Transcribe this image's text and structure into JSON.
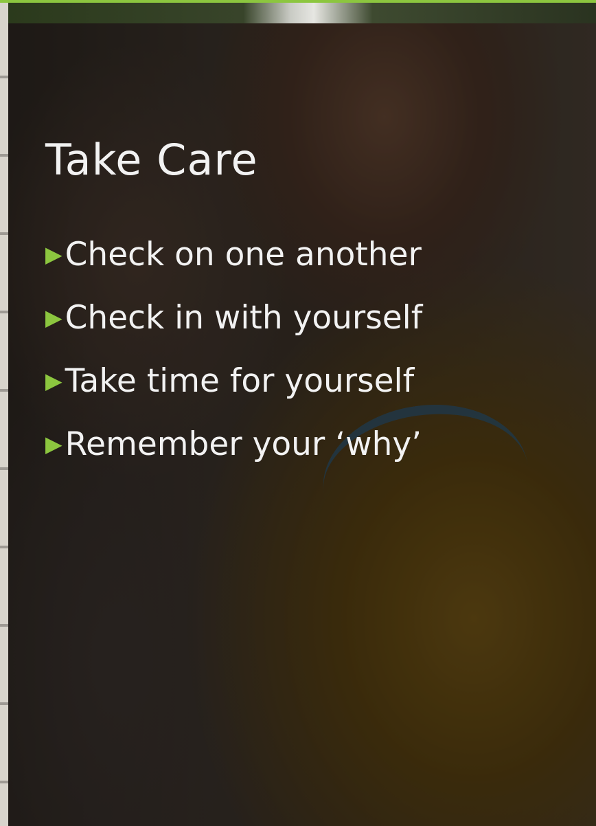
{
  "slide": {
    "title": "Take Care",
    "bullets": [
      {
        "icon": "triangle-right-icon",
        "text": "Check on one another"
      },
      {
        "icon": "triangle-right-icon",
        "text": "Check in with yourself"
      },
      {
        "icon": "triangle-right-icon",
        "text": "Take time for yourself"
      },
      {
        "icon": "triangle-right-icon",
        "text": "Remember your ‘why’"
      }
    ],
    "accent_color": "#8cc63f",
    "text_color": "#f2f2f2"
  }
}
